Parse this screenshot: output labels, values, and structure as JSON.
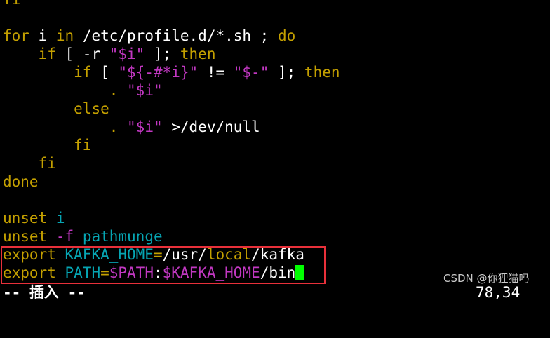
{
  "editor": {
    "lines": [
      [
        {
          "t": "fi",
          "c": "kw"
        }
      ],
      [],
      [
        {
          "t": "for",
          "c": "kw"
        },
        {
          "t": " i ",
          "c": "wt"
        },
        {
          "t": "in",
          "c": "kw"
        },
        {
          "t": " /etc/profile.d/*.sh ; ",
          "c": "wt"
        },
        {
          "t": "do",
          "c": "kw"
        }
      ],
      [
        {
          "t": "    ",
          "c": "wt"
        },
        {
          "t": "if",
          "c": "kw"
        },
        {
          "t": " [ -r ",
          "c": "wt"
        },
        {
          "t": "\"$i\"",
          "c": "mg"
        },
        {
          "t": " ]; ",
          "c": "wt"
        },
        {
          "t": "then",
          "c": "kw"
        }
      ],
      [
        {
          "t": "        ",
          "c": "wt"
        },
        {
          "t": "if",
          "c": "kw"
        },
        {
          "t": " [ ",
          "c": "wt"
        },
        {
          "t": "\"${-#*i}\"",
          "c": "mg"
        },
        {
          "t": " != ",
          "c": "wt"
        },
        {
          "t": "\"$-\"",
          "c": "mg"
        },
        {
          "t": " ]; ",
          "c": "wt"
        },
        {
          "t": "then",
          "c": "kw"
        }
      ],
      [
        {
          "t": "            ",
          "c": "wt"
        },
        {
          "t": ".",
          "c": "kw"
        },
        {
          "t": " ",
          "c": "wt"
        },
        {
          "t": "\"$i\"",
          "c": "mg"
        }
      ],
      [
        {
          "t": "        ",
          "c": "wt"
        },
        {
          "t": "else",
          "c": "kw"
        }
      ],
      [
        {
          "t": "            ",
          "c": "wt"
        },
        {
          "t": ".",
          "c": "kw"
        },
        {
          "t": " ",
          "c": "wt"
        },
        {
          "t": "\"$i\"",
          "c": "mg"
        },
        {
          "t": " >/dev/null",
          "c": "wt"
        }
      ],
      [
        {
          "t": "        ",
          "c": "wt"
        },
        {
          "t": "fi",
          "c": "kw"
        }
      ],
      [
        {
          "t": "    ",
          "c": "wt"
        },
        {
          "t": "fi",
          "c": "kw"
        }
      ],
      [
        {
          "t": "done",
          "c": "kw"
        }
      ],
      [],
      [
        {
          "t": "unset",
          "c": "kw"
        },
        {
          "t": " ",
          "c": "wt"
        },
        {
          "t": "i",
          "c": "cy"
        }
      ],
      [
        {
          "t": "unset",
          "c": "kw"
        },
        {
          "t": " ",
          "c": "wt"
        },
        {
          "t": "-f",
          "c": "mg"
        },
        {
          "t": " ",
          "c": "wt"
        },
        {
          "t": "pathmunge",
          "c": "cy"
        }
      ],
      [
        {
          "t": "export",
          "c": "kw"
        },
        {
          "t": " ",
          "c": "wt"
        },
        {
          "t": "KAFKA_HOME",
          "c": "cy"
        },
        {
          "t": "=",
          "c": "kw"
        },
        {
          "t": "/usr/",
          "c": "wt"
        },
        {
          "t": "local",
          "c": "kw"
        },
        {
          "t": "/kafka",
          "c": "wt"
        }
      ],
      [
        {
          "t": "export",
          "c": "kw"
        },
        {
          "t": " ",
          "c": "wt"
        },
        {
          "t": "PATH",
          "c": "cy"
        },
        {
          "t": "=",
          "c": "kw"
        },
        {
          "t": "$PATH",
          "c": "mg"
        },
        {
          "t": ":",
          "c": "wt"
        },
        {
          "t": "$KAFKA_HOME",
          "c": "mg"
        },
        {
          "t": "/bin",
          "c": "wt"
        }
      ]
    ]
  },
  "status": {
    "mode": "-- 插入 --",
    "position": "78,34"
  },
  "watermark": "CSDN @你狸猫吗",
  "colors": {
    "background": "#000000",
    "keyword": "#c4a000",
    "variable": "#06a5b3",
    "string": "#c238c2",
    "text": "#ffffff",
    "cursor": "#00ff00",
    "highlight_box": "#e8303a"
  }
}
